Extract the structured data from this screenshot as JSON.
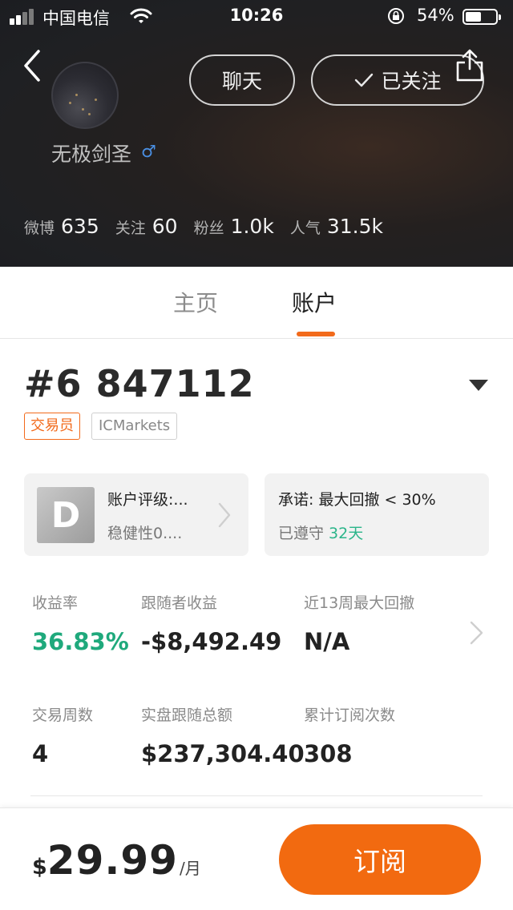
{
  "status_bar": {
    "carrier": "中国电信",
    "time": "10:26",
    "battery_percent": "54%",
    "battery_level": 0.54
  },
  "profile": {
    "username": "无极剑圣",
    "gender_symbol": "♂",
    "chat_label": "聊天",
    "follow_label": "已关注",
    "stats": [
      {
        "label": "微博",
        "value": "635"
      },
      {
        "label": "关注",
        "value": "60"
      },
      {
        "label": "粉丝",
        "value": "1.0k"
      },
      {
        "label": "人气",
        "value": "31.5k"
      }
    ]
  },
  "tabs": {
    "home": "主页",
    "account": "账户",
    "active": "account"
  },
  "account": {
    "id": "#6 847112",
    "tags": {
      "trader": "交易员",
      "broker": "ICMarkets"
    },
    "rating": {
      "grade": "D",
      "title": "账户评级:...",
      "subtitle": "稳健性0...."
    },
    "pledge": {
      "title": "承诺: 最大回撤 < 30%",
      "status": "已遵守",
      "days": "32天"
    },
    "metrics": [
      {
        "label": "收益率",
        "value": "36.83%"
      },
      {
        "label": "跟随者收益",
        "value": "-$8,492.49"
      },
      {
        "label": "近13周最大回撤",
        "value": "N/A"
      },
      {
        "label": "交易周数",
        "value": "4"
      },
      {
        "label": "实盘跟随总额",
        "value": "$237,304.40"
      },
      {
        "label": "累计订阅次数",
        "value": "308"
      }
    ]
  },
  "subscription": {
    "currency": "$",
    "price": "29.99",
    "unit": "/月",
    "button_label": "订阅"
  },
  "colors": {
    "accent": "#f26a10",
    "positive": "#1fa97c",
    "header_bg": "#1f2023"
  }
}
